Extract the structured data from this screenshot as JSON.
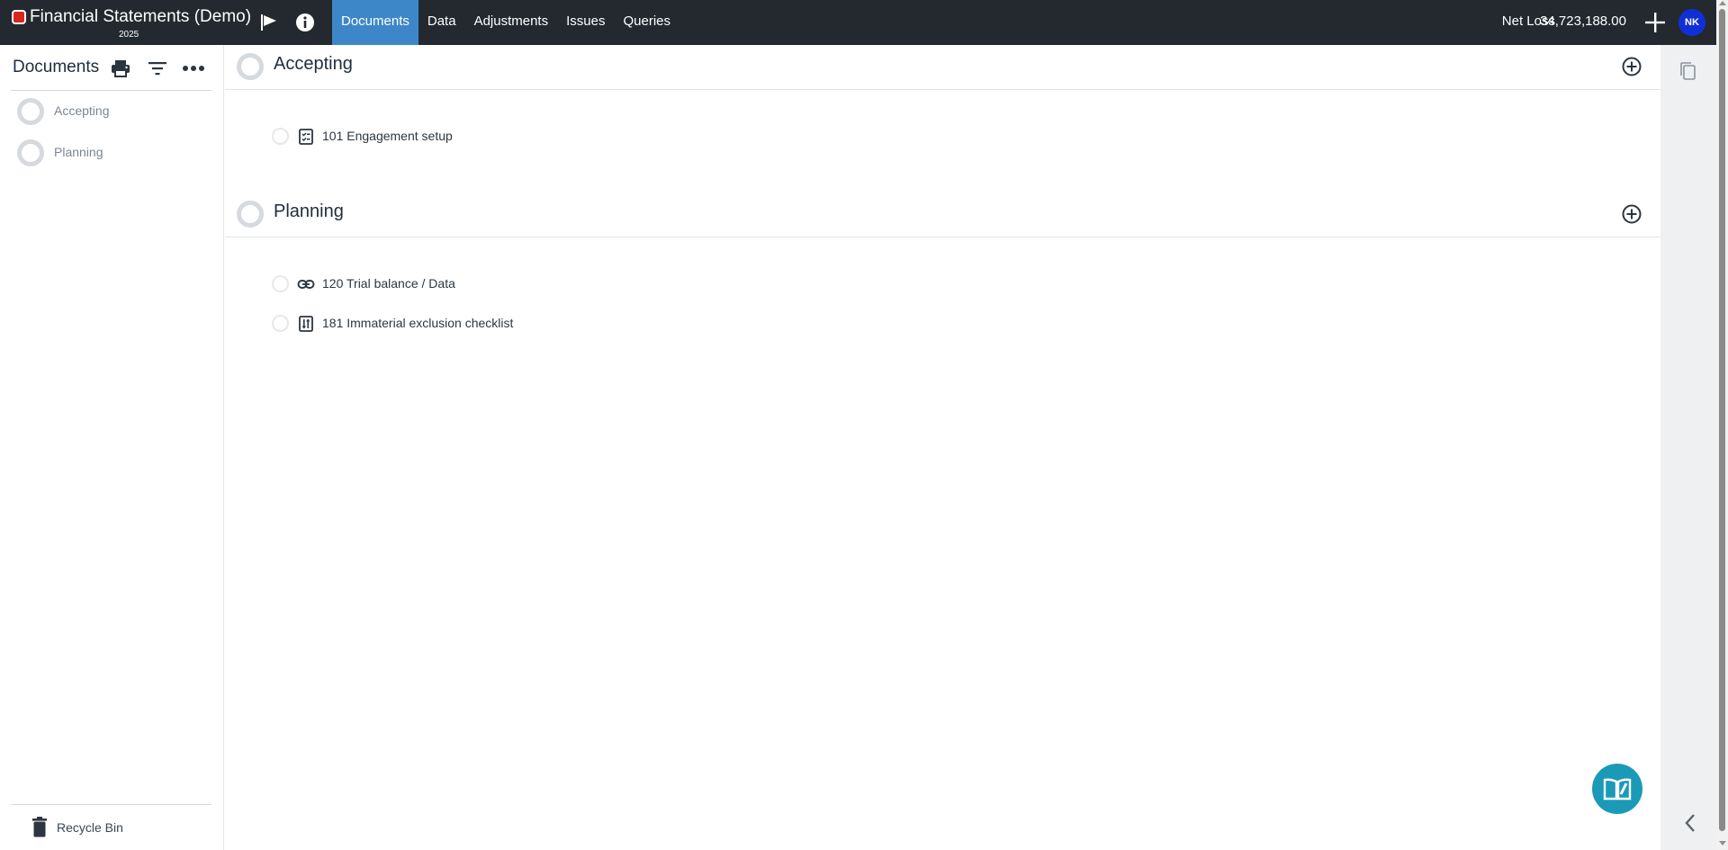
{
  "app": {
    "title": "Financial Statements (Demo)",
    "year": "2025"
  },
  "nav": [
    {
      "label": "Documents",
      "active": true
    },
    {
      "label": "Data",
      "active": false
    },
    {
      "label": "Adjustments",
      "active": false
    },
    {
      "label": "Issues",
      "active": false
    },
    {
      "label": "Queries",
      "active": false
    }
  ],
  "header": {
    "net_label": "Net Loss",
    "net_value": "34,723,188.00",
    "avatar": "NK"
  },
  "sidebar": {
    "title": "Documents",
    "items": [
      {
        "label": "Accepting"
      },
      {
        "label": "Planning"
      }
    ],
    "recycle_bin": "Recycle Bin"
  },
  "sections": [
    {
      "title": "Accepting",
      "docs": [
        {
          "label": "101 Engagement setup",
          "icon": "checklist-icon"
        }
      ]
    },
    {
      "title": "Planning",
      "docs": [
        {
          "label": "120 Trial balance / Data",
          "icon": "link-icon"
        },
        {
          "label": "181 Immaterial exclusion checklist",
          "icon": "sort-list-icon"
        }
      ]
    }
  ],
  "colors": {
    "topbar": "#23292f",
    "active_tab": "#3d87c9",
    "avatar": "#1030d6",
    "fab": "#1b9ab7",
    "brand": "#d7261e"
  }
}
